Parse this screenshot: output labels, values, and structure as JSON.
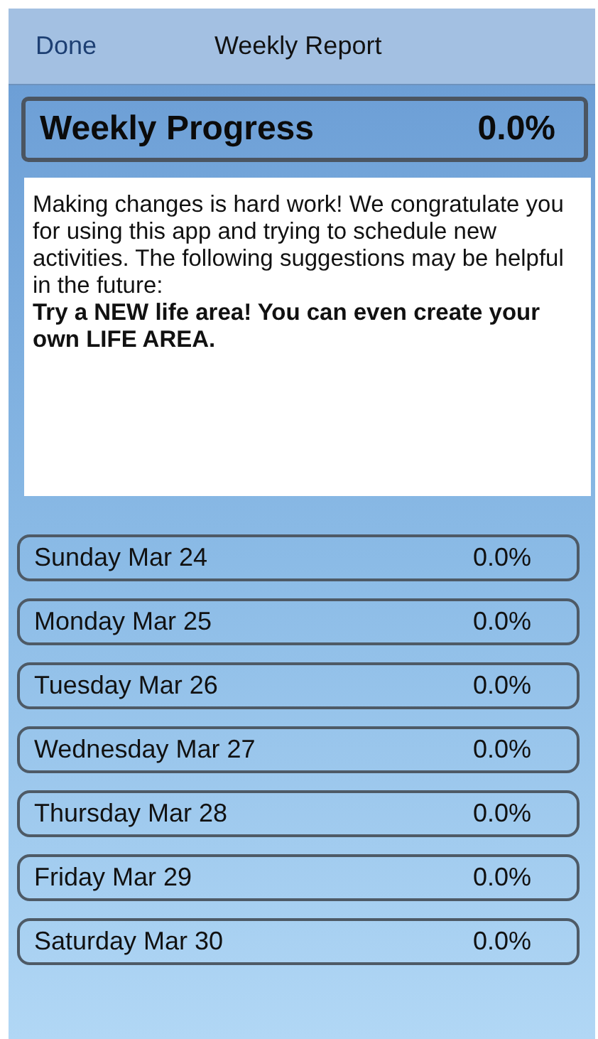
{
  "nav": {
    "back": "Done",
    "title": "Weekly Report"
  },
  "summary": {
    "label": "Weekly Progress",
    "value": "0.0%"
  },
  "message": "Making changes is hard work! We congratulate you for using this app and trying to schedule new activities. The following suggestions may be helpful in the future:\n**Try a NEW life area! You can even create your own LIFE AREA.**",
  "days": [
    {
      "label": "Sunday Mar 24",
      "value": "0.0%"
    },
    {
      "label": "Monday Mar 25",
      "value": "0.0%"
    },
    {
      "label": "Tuesday Mar 26",
      "value": "0.0%"
    },
    {
      "label": "Wednesday Mar 27",
      "value": "0.0%"
    },
    {
      "label": "Thursday Mar 28",
      "value": "0.0%"
    },
    {
      "label": "Friday Mar 29",
      "value": "0.0%"
    },
    {
      "label": "Saturday Mar 30",
      "value": "0.0%"
    }
  ]
}
